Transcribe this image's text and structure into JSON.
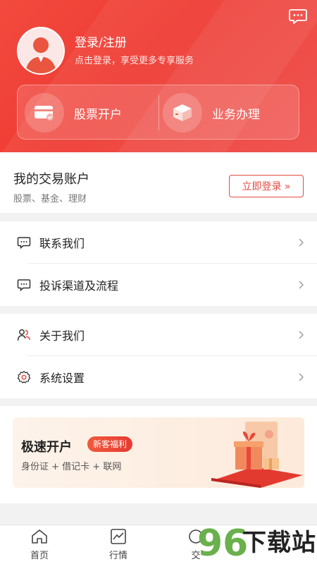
{
  "header": {
    "login_title": "登录/注册",
    "login_subtitle": "点击登录，享受更多专享服务",
    "actions": [
      {
        "label": "股票开户",
        "icon": "bank-card-icon"
      },
      {
        "label": "业务办理",
        "icon": "box-icon"
      }
    ],
    "message_icon": "message-icon"
  },
  "account": {
    "title": "我的交易账户",
    "subtitle": "股票、基金、理财",
    "login_button": "立即登录 »"
  },
  "menu_group_1": [
    {
      "label": "联系我们",
      "icon": "chat-bubble-icon"
    },
    {
      "label": "投诉渠道及流程",
      "icon": "chat-bubble-icon"
    }
  ],
  "menu_group_2": [
    {
      "label": "关于我们",
      "icon": "people-icon"
    },
    {
      "label": "系统设置",
      "icon": "gear-icon"
    }
  ],
  "promo": {
    "title": "极速开户",
    "badge": "新客福利",
    "subtitle": "身份证 + 借记卡 + 联网"
  },
  "tabbar": [
    {
      "label": "首页",
      "icon": "home-icon"
    },
    {
      "label": "行情",
      "icon": "chart-icon"
    },
    {
      "label": "交",
      "icon": "trade-icon"
    }
  ],
  "watermark": {
    "number": "96",
    "text": "下载站"
  },
  "colors": {
    "brand_red": "#ef3b33",
    "accent": "#e34a40"
  }
}
